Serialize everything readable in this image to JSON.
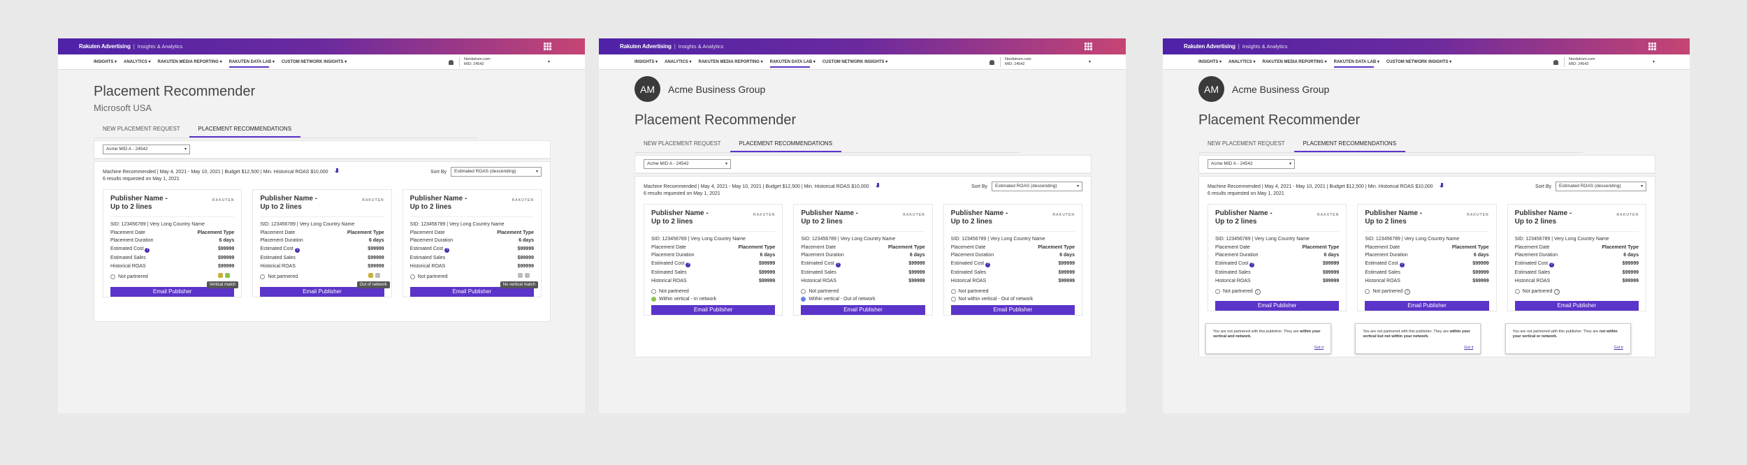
{
  "header": {
    "brand": "Rakuten Advertising",
    "product": "Insights & Analytics"
  },
  "nav": {
    "items": [
      "INSIGHTS ▾",
      "ANALYTICS ▾",
      "RAKUTEN MEDIA REPORTING ▾",
      "RAKUTEN DATA LAB ▾",
      "CUSTOM NETWORK INSIGHTS ▾"
    ],
    "account_line1": "Nordstrom.com",
    "account_line2": "MID: 24542"
  },
  "org": {
    "initials": "AM",
    "name": "Acme Business Group"
  },
  "page": {
    "title": "Placement Recommender",
    "advertiser": "Microsoft USA"
  },
  "tabs": [
    "NEW PLACEMENT REQUEST",
    "PLACEMENT RECOMMENDATIONS"
  ],
  "mid_select": "Acme MID A - 24542",
  "results": {
    "summary": "Machine Recommended | May 4, 2021 - May 10, 2021 | Budget $12,500 | Min. Historical ROAS $10,000",
    "count_line": "6 results requested on May 1, 2021",
    "sort_label": "Sort By",
    "sort_value": "Estimated ROAS (descending)"
  },
  "card": {
    "publisher_line1": "Publisher Name -",
    "publisher_line2": "Up to 2 lines",
    "logo": "RAKUTEN",
    "sid": "SID: 123456789 | Very Long Country Name",
    "rows": [
      {
        "k": "Placement Date",
        "v": "Placement Type"
      },
      {
        "k": "Placement Duration",
        "v": "6 days"
      },
      {
        "k": "Estimated Cost",
        "v": "$99999"
      },
      {
        "k": "Estimated Sales",
        "v": "$99999"
      },
      {
        "k": "Historical ROAS",
        "v": "$99999"
      }
    ],
    "not_partnered": "Not partnered",
    "email_button": "Email Publisher"
  },
  "frame1_status": [
    "Within vertical - In network",
    "Within vertical - Out of network",
    "Not within vertical - Out of network"
  ],
  "frame0_tooltips": [
    "Vertical match",
    "Out of network",
    "No vertical match"
  ],
  "frame2_popovers": [
    {
      "pre": "You are not partnered with this publisher. They are ",
      "bold": "within your vertical and network."
    },
    {
      "pre": "You are not partnered with this publisher. They are ",
      "bold": "within your vertical but not within your network."
    },
    {
      "pre": "You are not partnered with this publisher. They are ",
      "bold": "not within your vertical or network."
    }
  ],
  "got_it": "Got it",
  "colors": {
    "accent": "#5b34c9",
    "gradient_start": "#4f22a8",
    "gradient_end": "#c64573"
  }
}
